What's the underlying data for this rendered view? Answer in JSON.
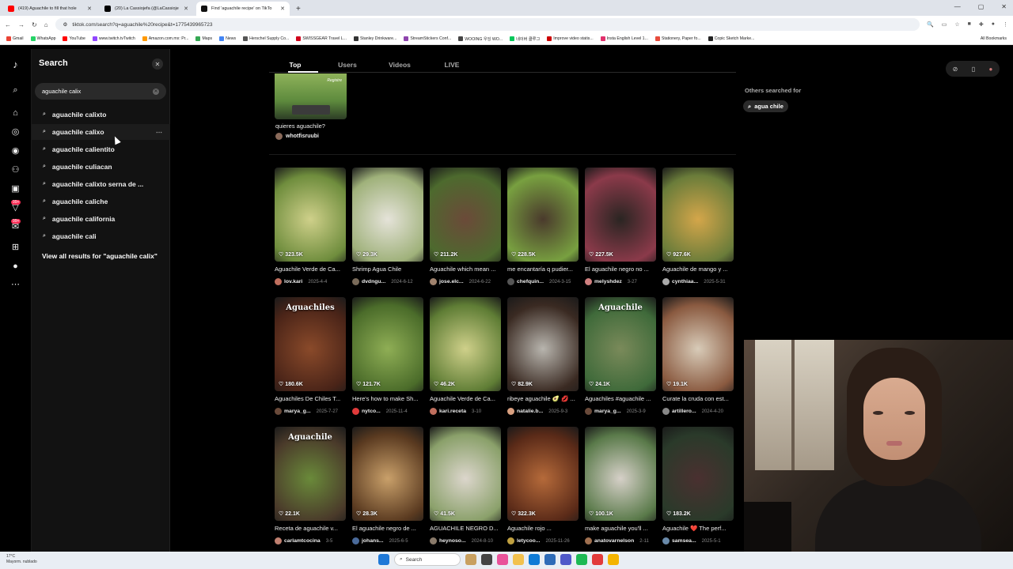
{
  "browser": {
    "tabs": [
      {
        "title": "(419) Aguachile to fill that hole",
        "favicon_color": "#ff0000",
        "active": false
      },
      {
        "title": "(20) La Cassiojefa (@LaCassioje",
        "favicon_color": "#000000",
        "active": false
      },
      {
        "title": "Find 'aguachile recipe' on TikTo",
        "favicon_color": "#111111",
        "active": true
      }
    ],
    "url": "tiktok.com/search?q=aguachile%20recipe&t=1775439965723",
    "bookmarks": [
      {
        "label": "Gmail",
        "color": "#ea4335"
      },
      {
        "label": "WhatsApp",
        "color": "#25d366"
      },
      {
        "label": "YouTube",
        "color": "#ff0000"
      },
      {
        "label": "www.twitch.tvTwitch",
        "color": "#9146ff"
      },
      {
        "label": "Amazon.com.mx: Pr...",
        "color": "#ff9900"
      },
      {
        "label": "Maps",
        "color": "#34a853"
      },
      {
        "label": "News",
        "color": "#4285f4"
      },
      {
        "label": "Herschel Supply Co...",
        "color": "#555555"
      },
      {
        "label": "SWISSGEAR Travel L...",
        "color": "#d0021b"
      },
      {
        "label": "Stanley Drinkware...",
        "color": "#333333"
      },
      {
        "label": "StreamStickers Conf...",
        "color": "#8e44ad"
      },
      {
        "label": "WOOING 우잉 WO...",
        "color": "#444444"
      },
      {
        "label": "네이버 클루그",
        "color": "#03c75a"
      },
      {
        "label": "Improve video statis...",
        "color": "#cc0000"
      },
      {
        "label": "Insta English Level 1...",
        "color": "#e1306c"
      },
      {
        "label": "Stationery, Paper fo...",
        "color": "#e74c3c"
      },
      {
        "label": "Copic Sketch Marke...",
        "color": "#222222"
      }
    ],
    "all_bookmarks": "All Bookmarks"
  },
  "sidebar_badges": [
    "99+",
    "99+"
  ],
  "search_panel": {
    "title": "Search",
    "query": "aguachile calix",
    "suggestions": [
      "aguachile calixto",
      "aguachile calixo",
      "aguachile calientito",
      "aguachile culiacan",
      "aguachile calixto serna de ...",
      "aguachile caliche",
      "aguachile california",
      "aguachile cali"
    ],
    "view_all": "View all results for \"aguachile calix\""
  },
  "results_tabs": [
    "Top",
    "Users",
    "Videos",
    "LIVE"
  ],
  "top_video": {
    "overlay": "Registre",
    "caption": "quieres aguachile?",
    "user": "whotfisruubi"
  },
  "videos": [
    {
      "likes": "323.5K",
      "caption": "Aguachile Verde de Ca...",
      "user": "lov.kari",
      "date": "2025-4-4",
      "overlay": "",
      "bg": [
        "#cfd08a",
        "#6f8d3d"
      ],
      "avatar": "#c06f5e"
    },
    {
      "likes": "29.3K",
      "caption": "Shrimp Agua Chile",
      "user": "dvdngu...",
      "date": "2024-6-12",
      "overlay": "",
      "bg": [
        "#e5e3d9",
        "#9fb17a"
      ],
      "avatar": "#7a6b5a"
    },
    {
      "likes": "211.2K",
      "caption": "Aguachile which mean ...",
      "user": "jose.elc...",
      "date": "2024-6-22",
      "overlay": "",
      "bg": [
        "#6b4a39",
        "#4d6a2e"
      ],
      "avatar": "#a0826d"
    },
    {
      "likes": "228.5K",
      "caption": "me encantaría q pudier...",
      "user": "chefquin...",
      "date": "2024-3-15",
      "overlay": "",
      "bg": [
        "#4a3a2c",
        "#78a040"
      ],
      "avatar": "#555555"
    },
    {
      "likes": "227.5K",
      "caption": "El aguachile negro no ...",
      "user": "melyshdez",
      "date": "3-27",
      "overlay": "",
      "bg": [
        "#2a2522",
        "#8b3a4a"
      ],
      "avatar": "#d08080"
    },
    {
      "likes": "927.6K",
      "caption": "Aguachile de mango y ...",
      "user": "cynthiaa...",
      "date": "2025-5-31",
      "overlay": "",
      "bg": [
        "#d4a64a",
        "#6a7c3a"
      ],
      "avatar": "#aaaaaa"
    },
    {
      "likes": "180.6K",
      "caption": "Aguachiles De Chiles T...",
      "user": "marya_g...",
      "date": "2025-7-27",
      "overlay": "Aguachiles",
      "bg": [
        "#8a4a2a",
        "#4a2418"
      ],
      "avatar": "#6a4a3a"
    },
    {
      "likes": "121.7K",
      "caption": "Here's how to make Sh...",
      "user": "nytco...",
      "date": "2025-11-4",
      "overlay": "",
      "bg": [
        "#8fae55",
        "#4b6c2a"
      ],
      "avatar": "#e03a3a"
    },
    {
      "likes": "46.2K",
      "caption": "Aguachile Verde de Ca...",
      "user": "kari.receta",
      "date": "3-10",
      "overlay": "",
      "bg": [
        "#cfd08a",
        "#5f7d35"
      ],
      "avatar": "#c06f5e"
    },
    {
      "likes": "82.9K",
      "caption": "ribeye aguachile 🥑 💋 ...",
      "user": "natalie.b...",
      "date": "2025-9-3",
      "overlay": "",
      "bg": [
        "#b8b5ae",
        "#3a2a22"
      ],
      "avatar": "#d9a080"
    },
    {
      "likes": "24.1K",
      "caption": "Aguachiles #aguachile ...",
      "user": "marya_g...",
      "date": "2025-3-9",
      "overlay": "Aguachile",
      "bg": [
        "#7a8a5a",
        "#3f6a3a"
      ],
      "avatar": "#6a4a3a"
    },
    {
      "likes": "19.1K",
      "caption": "Curate la cruda con est...",
      "user": "artillero...",
      "date": "2024-4-20",
      "overlay": "",
      "bg": [
        "#d8cbb8",
        "#8a5a40"
      ],
      "avatar": "#888888"
    },
    {
      "likes": "22.1K",
      "caption": "Receta de aguachile v...",
      "user": "carlamtcocina",
      "date": "3-5",
      "overlay": "Aguachile",
      "bg": [
        "#6a8a3a",
        "#4a3a2a"
      ],
      "avatar": "#c08070"
    },
    {
      "likes": "28.3K",
      "caption": "El aguachile negro de ...",
      "user": "johans...",
      "date": "2025-6-5",
      "overlay": "",
      "bg": [
        "#c9a06a",
        "#5a3a20"
      ],
      "avatar": "#4a6a9a"
    },
    {
      "likes": "41.5K",
      "caption": "AGUACHILE NEGRO D...",
      "user": "heynoso...",
      "date": "2024-8-10",
      "overlay": "",
      "bg": [
        "#dcd6cc",
        "#8aa06a"
      ],
      "avatar": "#8a7a6a"
    },
    {
      "likes": "322.3K",
      "caption": "Aguachile rojo ...",
      "user": "letycoo...",
      "date": "2025-11-26",
      "overlay": "",
      "bg": [
        "#b56a3a",
        "#5a2a18"
      ],
      "avatar": "#c0a040"
    },
    {
      "likes": "100.1K",
      "caption": "make aguachile you'll ...",
      "user": "anatovarnelson",
      "date": "2-11",
      "overlay": "",
      "bg": [
        "#d6d0c8",
        "#5a7a4a"
      ],
      "avatar": "#a07050"
    },
    {
      "likes": "183.2K",
      "caption": "Aguachile ❤️ The perf...",
      "user": "samsea...",
      "date": "2025-5-1",
      "overlay": "",
      "bg": [
        "#4a3030",
        "#2a3a2a"
      ],
      "avatar": "#6a8aaa"
    }
  ],
  "related": {
    "title": "Others searched for",
    "chip": "agua chile"
  },
  "taskbar": {
    "temp": "17°C",
    "weather": "Mayorm. nublado",
    "search": "Search"
  }
}
